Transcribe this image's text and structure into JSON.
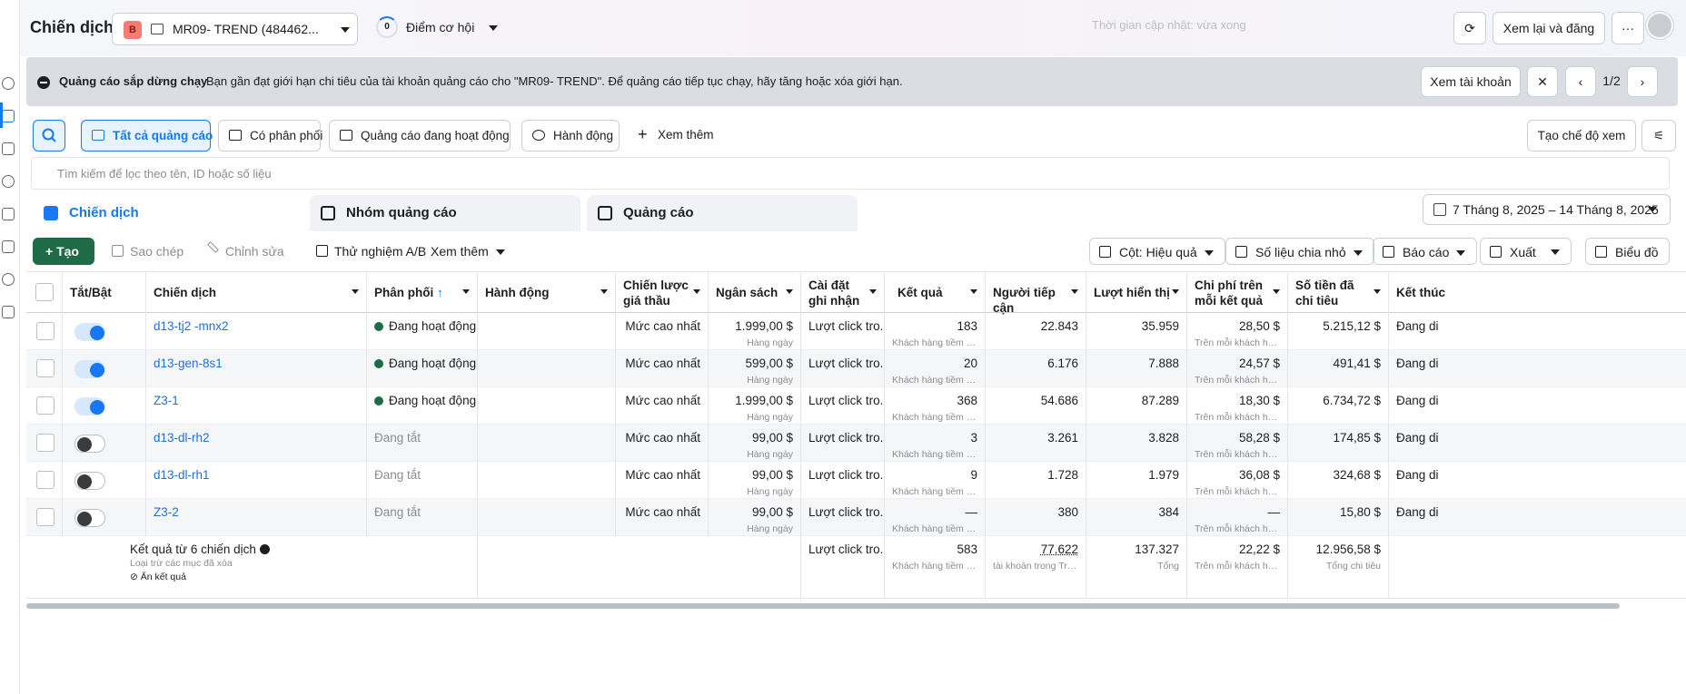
{
  "header": {
    "title": "Chiến dịch",
    "account_badge": "B",
    "account_name": "MR09- TREND (484462...",
    "opportunity_count": "0",
    "opportunity_label": "Điểm cơ hội",
    "update_text": "Thời gian cập nhật: vừa xong",
    "review_button": "Xem lại và đăng",
    "more_button": "···"
  },
  "banner": {
    "title": "Quảng cáo sắp dừng chạy",
    "message": "Bạn gần đạt giới hạn chi tiêu của tài khoản quảng cáo cho \"MR09- TREND\". Để quảng cáo tiếp tục chạy, hãy tăng hoặc xóa giới hạn.",
    "view_account": "Xem tài khoản",
    "close": "✕",
    "prev": "‹",
    "page": "1/2",
    "next": "›"
  },
  "filters": {
    "all_ads": "Tất cả quảng cáo",
    "delivery": "Có phân phối",
    "active_ads": "Quảng cáo đang hoạt động",
    "actions": "Hành động",
    "more": "Xem thêm",
    "create_view": "Tạo chế độ xem"
  },
  "search": {
    "placeholder": "Tìm kiếm để lọc theo tên, ID hoặc số liệu"
  },
  "tabs": {
    "campaigns": "Chiến dịch",
    "adsets": "Nhóm quảng cáo",
    "ads": "Quảng cáo"
  },
  "date_range": "7 Tháng 8, 2025 – 14 Tháng 8, 2025",
  "toolbar": {
    "create": "Tạo",
    "duplicate": "Sao chép",
    "edit": "Chỉnh sửa",
    "ab_test": "Thử nghiệm A/B",
    "more": "Xem thêm",
    "columns": "Cột: Hiệu quả",
    "breakdown": "Số liệu chia nhỏ",
    "reports": "Báo cáo",
    "export": "Xuất",
    "charts": "Biểu đồ"
  },
  "table": {
    "headers": {
      "toggle": "Tắt/Bật",
      "campaign": "Chiến dịch",
      "delivery": "Phân phối",
      "sort_arrow": "↑",
      "actions": "Hành động",
      "bid_strategy": "Chiến lược giá thầu",
      "budget": "Ngân sách",
      "attribution": "Cài đặt ghi nhận",
      "results": "Kết quả",
      "reach": "Người tiếp cận",
      "impressions": "Lượt hiển thị",
      "cost_per_result": "Chi phí trên mỗi kết quả",
      "amount_spent": "Số tiền đã chi tiêu",
      "end": "Kết thúc"
    },
    "rows": [
      {
        "name": "d13-tj2 -mnx2",
        "on": true,
        "delivery": "Đang hoạt động",
        "bid": "Mức cao nhất",
        "budget": "1.999,00 $",
        "budget_sub": "Hàng ngày",
        "attr": "Lượt click tro...",
        "results": "183",
        "results_sub": "Khách hàng tiềm năng...",
        "reach": "22.843",
        "impr": "35.959",
        "cpr": "28,50 $",
        "cpr_sub": "Trên mỗi khách hàng t...",
        "spent": "5.215,12 $",
        "end": "Đang di"
      },
      {
        "name": "d13-gen-8s1",
        "on": true,
        "delivery": "Đang hoạt động",
        "bid": "Mức cao nhất",
        "budget": "599,00 $",
        "budget_sub": "Hàng ngày",
        "attr": "Lượt click tro...",
        "results": "20",
        "results_sub": "Khách hàng tiềm năng...",
        "reach": "6.176",
        "impr": "7.888",
        "cpr": "24,57 $",
        "cpr_sub": "Trên mỗi khách hàng t...",
        "spent": "491,41 $",
        "end": "Đang di"
      },
      {
        "name": "Z3-1",
        "on": true,
        "delivery": "Đang hoạt động",
        "bid": "Mức cao nhất",
        "budget": "1.999,00 $",
        "budget_sub": "Hàng ngày",
        "attr": "Lượt click tro...",
        "results": "368",
        "results_sub": "Khách hàng tiềm năng...",
        "reach": "54.686",
        "impr": "87.289",
        "cpr": "18,30 $",
        "cpr_sub": "Trên mỗi khách hàng t...",
        "spent": "6.734,72 $",
        "end": "Đang di"
      },
      {
        "name": "d13-dl-rh2",
        "on": false,
        "delivery": "Đang tắt",
        "bid": "Mức cao nhất",
        "budget": "99,00 $",
        "budget_sub": "Hàng ngày",
        "attr": "Lượt click tro...",
        "results": "3",
        "results_sub": "Khách hàng tiềm năng...",
        "reach": "3.261",
        "impr": "3.828",
        "cpr": "58,28 $",
        "cpr_sub": "Trên mỗi khách hàng t...",
        "spent": "174,85 $",
        "end": "Đang di"
      },
      {
        "name": "d13-dl-rh1",
        "on": false,
        "delivery": "Đang tắt",
        "bid": "Mức cao nhất",
        "budget": "99,00 $",
        "budget_sub": "Hàng ngày",
        "attr": "Lượt click tro...",
        "results": "9",
        "results_sub": "Khách hàng tiềm năng...",
        "reach": "1.728",
        "impr": "1.979",
        "cpr": "36,08 $",
        "cpr_sub": "Trên mỗi khách hàng t...",
        "spent": "324,68 $",
        "end": "Đang di"
      },
      {
        "name": "Z3-2",
        "on": false,
        "delivery": "Đang tắt",
        "bid": "Mức cao nhất",
        "budget": "99,00 $",
        "budget_sub": "Hàng ngày",
        "attr": "Lượt click tro...",
        "results": "—",
        "results_sub": "Khách hàng tiềm năng...",
        "reach": "380",
        "impr": "384",
        "cpr": "—",
        "cpr_sub": "Trên mỗi khách hàng t...",
        "spent": "15,80 $",
        "end": "Đang di"
      }
    ],
    "totals": {
      "label": "Kết quả từ 6 chiến dịch",
      "sub": "Loại trừ các mục đã xóa",
      "hide": "Ẩn kết quả",
      "attr": "Lượt click tro...",
      "results": "583",
      "results_sub": "Khách hàng tiềm năn...",
      "reach": "77.622",
      "reach_sub": "tài khoản trong Trung ...",
      "impr": "137.327",
      "impr_sub": "Tổng",
      "cpr": "22,22 $",
      "cpr_sub": "Trên mỗi khách hàng t...",
      "spent": "12.956,58 $",
      "spent_sub": "Tổng chi tiêu"
    }
  }
}
